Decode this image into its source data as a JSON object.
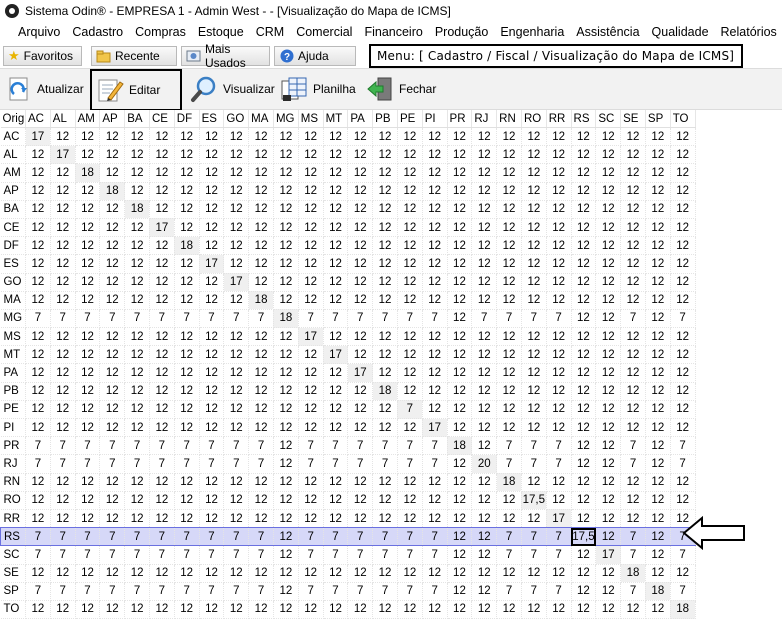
{
  "window": {
    "title": "Sistema Odin® - EMPRESA 1 - Admin West -  - [Visualização do Mapa de ICMS]"
  },
  "menu": [
    "Arquivo",
    "Cadastro",
    "Compras",
    "Estoque",
    "CRM",
    "Comercial",
    "Financeiro",
    "Produção",
    "Engenharia",
    "Assistência",
    "Qualidade",
    "Relatórios"
  ],
  "tabs": [
    {
      "label": "Favoritos",
      "icon": "star-icon"
    },
    {
      "label": "Recente",
      "icon": "recent-folder-icon"
    },
    {
      "label": "Mais Usados",
      "icon": "most-used-icon"
    },
    {
      "label": "Ajuda",
      "icon": "help-icon"
    }
  ],
  "menu_path": "Menu: [ Cadastro / Fiscal / Visualização do Mapa de ICMS]",
  "toolbar": {
    "atualizar": "Atualizar",
    "editar": "Editar",
    "visualizar": "Visualizar",
    "planilha": "Planilha",
    "fechar": "Fechar"
  },
  "grid": {
    "corner": "Orig",
    "columns": [
      "AC",
      "AL",
      "AM",
      "AP",
      "BA",
      "CE",
      "DF",
      "ES",
      "GO",
      "MA",
      "MG",
      "MS",
      "MT",
      "PA",
      "PB",
      "PE",
      "PI",
      "PR",
      "RJ",
      "RN",
      "RO",
      "RR",
      "RS",
      "SC",
      "SE",
      "SP",
      "TO"
    ],
    "selected_row": "RS",
    "highlighted_cell": {
      "row": "RS",
      "col": "RS",
      "value": "17,5"
    },
    "rows": [
      {
        "orig": "AC",
        "values": [
          "17",
          "12",
          "12",
          "12",
          "12",
          "12",
          "12",
          "12",
          "12",
          "12",
          "12",
          "12",
          "12",
          "12",
          "12",
          "12",
          "12",
          "12",
          "12",
          "12",
          "12",
          "12",
          "12",
          "12",
          "12",
          "12",
          "12"
        ]
      },
      {
        "orig": "AL",
        "values": [
          "12",
          "17",
          "12",
          "12",
          "12",
          "12",
          "12",
          "12",
          "12",
          "12",
          "12",
          "12",
          "12",
          "12",
          "12",
          "12",
          "12",
          "12",
          "12",
          "12",
          "12",
          "12",
          "12",
          "12",
          "12",
          "12",
          "12"
        ]
      },
      {
        "orig": "AM",
        "values": [
          "12",
          "12",
          "18",
          "12",
          "12",
          "12",
          "12",
          "12",
          "12",
          "12",
          "12",
          "12",
          "12",
          "12",
          "12",
          "12",
          "12",
          "12",
          "12",
          "12",
          "12",
          "12",
          "12",
          "12",
          "12",
          "12",
          "12"
        ]
      },
      {
        "orig": "AP",
        "values": [
          "12",
          "12",
          "12",
          "18",
          "12",
          "12",
          "12",
          "12",
          "12",
          "12",
          "12",
          "12",
          "12",
          "12",
          "12",
          "12",
          "12",
          "12",
          "12",
          "12",
          "12",
          "12",
          "12",
          "12",
          "12",
          "12",
          "12"
        ]
      },
      {
        "orig": "BA",
        "values": [
          "12",
          "12",
          "12",
          "12",
          "18",
          "12",
          "12",
          "12",
          "12",
          "12",
          "12",
          "12",
          "12",
          "12",
          "12",
          "12",
          "12",
          "12",
          "12",
          "12",
          "12",
          "12",
          "12",
          "12",
          "12",
          "12",
          "12"
        ]
      },
      {
        "orig": "CE",
        "values": [
          "12",
          "12",
          "12",
          "12",
          "12",
          "17",
          "12",
          "12",
          "12",
          "12",
          "12",
          "12",
          "12",
          "12",
          "12",
          "12",
          "12",
          "12",
          "12",
          "12",
          "12",
          "12",
          "12",
          "12",
          "12",
          "12",
          "12"
        ]
      },
      {
        "orig": "DF",
        "values": [
          "12",
          "12",
          "12",
          "12",
          "12",
          "12",
          "18",
          "12",
          "12",
          "12",
          "12",
          "12",
          "12",
          "12",
          "12",
          "12",
          "12",
          "12",
          "12",
          "12",
          "12",
          "12",
          "12",
          "12",
          "12",
          "12",
          "12"
        ]
      },
      {
        "orig": "ES",
        "values": [
          "12",
          "12",
          "12",
          "12",
          "12",
          "12",
          "12",
          "17",
          "12",
          "12",
          "12",
          "12",
          "12",
          "12",
          "12",
          "12",
          "12",
          "12",
          "12",
          "12",
          "12",
          "12",
          "12",
          "12",
          "12",
          "12",
          "12"
        ]
      },
      {
        "orig": "GO",
        "values": [
          "12",
          "12",
          "12",
          "12",
          "12",
          "12",
          "12",
          "12",
          "17",
          "12",
          "12",
          "12",
          "12",
          "12",
          "12",
          "12",
          "12",
          "12",
          "12",
          "12",
          "12",
          "12",
          "12",
          "12",
          "12",
          "12",
          "12"
        ]
      },
      {
        "orig": "MA",
        "values": [
          "12",
          "12",
          "12",
          "12",
          "12",
          "12",
          "12",
          "12",
          "12",
          "18",
          "12",
          "12",
          "12",
          "12",
          "12",
          "12",
          "12",
          "12",
          "12",
          "12",
          "12",
          "12",
          "12",
          "12",
          "12",
          "12",
          "12"
        ]
      },
      {
        "orig": "MG",
        "values": [
          "7",
          "7",
          "7",
          "7",
          "7",
          "7",
          "7",
          "7",
          "7",
          "7",
          "18",
          "7",
          "7",
          "7",
          "7",
          "7",
          "7",
          "12",
          "7",
          "7",
          "7",
          "7",
          "12",
          "12",
          "7",
          "12",
          "7"
        ]
      },
      {
        "orig": "MS",
        "values": [
          "12",
          "12",
          "12",
          "12",
          "12",
          "12",
          "12",
          "12",
          "12",
          "12",
          "12",
          "17",
          "12",
          "12",
          "12",
          "12",
          "12",
          "12",
          "12",
          "12",
          "12",
          "12",
          "12",
          "12",
          "12",
          "12",
          "12"
        ]
      },
      {
        "orig": "MT",
        "values": [
          "12",
          "12",
          "12",
          "12",
          "12",
          "12",
          "12",
          "12",
          "12",
          "12",
          "12",
          "12",
          "17",
          "12",
          "12",
          "12",
          "12",
          "12",
          "12",
          "12",
          "12",
          "12",
          "12",
          "12",
          "12",
          "12",
          "12"
        ]
      },
      {
        "orig": "PA",
        "values": [
          "12",
          "12",
          "12",
          "12",
          "12",
          "12",
          "12",
          "12",
          "12",
          "12",
          "12",
          "12",
          "12",
          "17",
          "12",
          "12",
          "12",
          "12",
          "12",
          "12",
          "12",
          "12",
          "12",
          "12",
          "12",
          "12",
          "12"
        ]
      },
      {
        "orig": "PB",
        "values": [
          "12",
          "12",
          "12",
          "12",
          "12",
          "12",
          "12",
          "12",
          "12",
          "12",
          "12",
          "12",
          "12",
          "12",
          "18",
          "12",
          "12",
          "12",
          "12",
          "12",
          "12",
          "12",
          "12",
          "12",
          "12",
          "12",
          "12"
        ]
      },
      {
        "orig": "PE",
        "values": [
          "12",
          "12",
          "12",
          "12",
          "12",
          "12",
          "12",
          "12",
          "12",
          "12",
          "12",
          "12",
          "12",
          "12",
          "12",
          "7",
          "12",
          "12",
          "12",
          "12",
          "12",
          "12",
          "12",
          "12",
          "12",
          "12",
          "12"
        ]
      },
      {
        "orig": "PI",
        "values": [
          "12",
          "12",
          "12",
          "12",
          "12",
          "12",
          "12",
          "12",
          "12",
          "12",
          "12",
          "12",
          "12",
          "12",
          "12",
          "12",
          "17",
          "12",
          "12",
          "12",
          "12",
          "12",
          "12",
          "12",
          "12",
          "12",
          "12"
        ]
      },
      {
        "orig": "PR",
        "values": [
          "7",
          "7",
          "7",
          "7",
          "7",
          "7",
          "7",
          "7",
          "7",
          "7",
          "12",
          "7",
          "7",
          "7",
          "7",
          "7",
          "7",
          "18",
          "12",
          "7",
          "7",
          "7",
          "12",
          "12",
          "7",
          "12",
          "7"
        ]
      },
      {
        "orig": "RJ",
        "values": [
          "7",
          "7",
          "7",
          "7",
          "7",
          "7",
          "7",
          "7",
          "7",
          "7",
          "12",
          "7",
          "7",
          "7",
          "7",
          "7",
          "7",
          "12",
          "20",
          "7",
          "7",
          "7",
          "12",
          "12",
          "7",
          "12",
          "7"
        ]
      },
      {
        "orig": "RN",
        "values": [
          "12",
          "12",
          "12",
          "12",
          "12",
          "12",
          "12",
          "12",
          "12",
          "12",
          "12",
          "12",
          "12",
          "12",
          "12",
          "12",
          "12",
          "12",
          "12",
          "18",
          "12",
          "12",
          "12",
          "12",
          "12",
          "12",
          "12"
        ]
      },
      {
        "orig": "RO",
        "values": [
          "12",
          "12",
          "12",
          "12",
          "12",
          "12",
          "12",
          "12",
          "12",
          "12",
          "12",
          "12",
          "12",
          "12",
          "12",
          "12",
          "12",
          "12",
          "12",
          "12",
          "17,5",
          "12",
          "12",
          "12",
          "12",
          "12",
          "12"
        ]
      },
      {
        "orig": "RR",
        "values": [
          "12",
          "12",
          "12",
          "12",
          "12",
          "12",
          "12",
          "12",
          "12",
          "12",
          "12",
          "12",
          "12",
          "12",
          "12",
          "12",
          "12",
          "12",
          "12",
          "12",
          "12",
          "17",
          "12",
          "12",
          "12",
          "12",
          "12"
        ]
      },
      {
        "orig": "RS",
        "values": [
          "7",
          "7",
          "7",
          "7",
          "7",
          "7",
          "7",
          "7",
          "7",
          "7",
          "12",
          "7",
          "7",
          "7",
          "7",
          "7",
          "7",
          "12",
          "12",
          "7",
          "7",
          "7",
          "17,5",
          "12",
          "7",
          "12",
          "7"
        ]
      },
      {
        "orig": "SC",
        "values": [
          "7",
          "7",
          "7",
          "7",
          "7",
          "7",
          "7",
          "7",
          "7",
          "7",
          "12",
          "7",
          "7",
          "7",
          "7",
          "7",
          "7",
          "12",
          "12",
          "7",
          "7",
          "7",
          "12",
          "17",
          "7",
          "12",
          "7"
        ]
      },
      {
        "orig": "SE",
        "values": [
          "12",
          "12",
          "12",
          "12",
          "12",
          "12",
          "12",
          "12",
          "12",
          "12",
          "12",
          "12",
          "12",
          "12",
          "12",
          "12",
          "12",
          "12",
          "12",
          "12",
          "12",
          "12",
          "12",
          "12",
          "18",
          "12",
          "12"
        ]
      },
      {
        "orig": "SP",
        "values": [
          "7",
          "7",
          "7",
          "7",
          "7",
          "7",
          "7",
          "7",
          "7",
          "7",
          "12",
          "7",
          "7",
          "7",
          "7",
          "7",
          "7",
          "12",
          "12",
          "7",
          "7",
          "7",
          "12",
          "12",
          "7",
          "18",
          "7"
        ]
      },
      {
        "orig": "TO",
        "values": [
          "12",
          "12",
          "12",
          "12",
          "12",
          "12",
          "12",
          "12",
          "12",
          "12",
          "12",
          "12",
          "12",
          "12",
          "12",
          "12",
          "12",
          "12",
          "12",
          "12",
          "12",
          "12",
          "12",
          "12",
          "12",
          "12",
          "18"
        ]
      }
    ]
  },
  "colors": {
    "selection": "#d6d8f8",
    "selection_border": "#6a70e0",
    "diagonal": "#f0f0f0"
  }
}
